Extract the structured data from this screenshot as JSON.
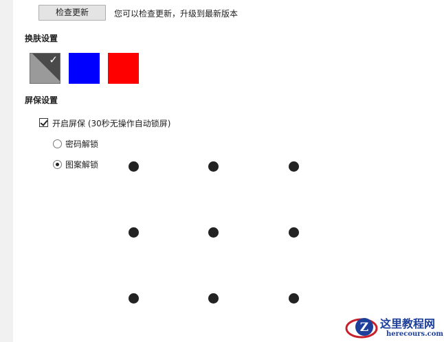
{
  "update": {
    "button_label": "检查更新",
    "hint": "您可以检查更新，升级到最新版本"
  },
  "skin": {
    "title": "换肤设置",
    "swatches": [
      {
        "name": "gray",
        "color": "#9a9a9a",
        "selected": true
      },
      {
        "name": "blue",
        "color": "#0000ff",
        "selected": false
      },
      {
        "name": "red",
        "color": "#ff0000",
        "selected": false
      }
    ],
    "check_glyph": "✓"
  },
  "screensaver": {
    "title": "屏保设置",
    "enable_label": "开启屏保 (30秒无操作自动锁屏)",
    "enabled": true,
    "unlock_options": [
      {
        "label": "密码解锁",
        "selected": false
      },
      {
        "label": "图案解锁",
        "selected": true
      }
    ],
    "pattern_grid": {
      "rows": 3,
      "cols": 3
    }
  },
  "watermark": {
    "site_name_cn": "这里教程网",
    "site_domain": "herecours.com"
  }
}
